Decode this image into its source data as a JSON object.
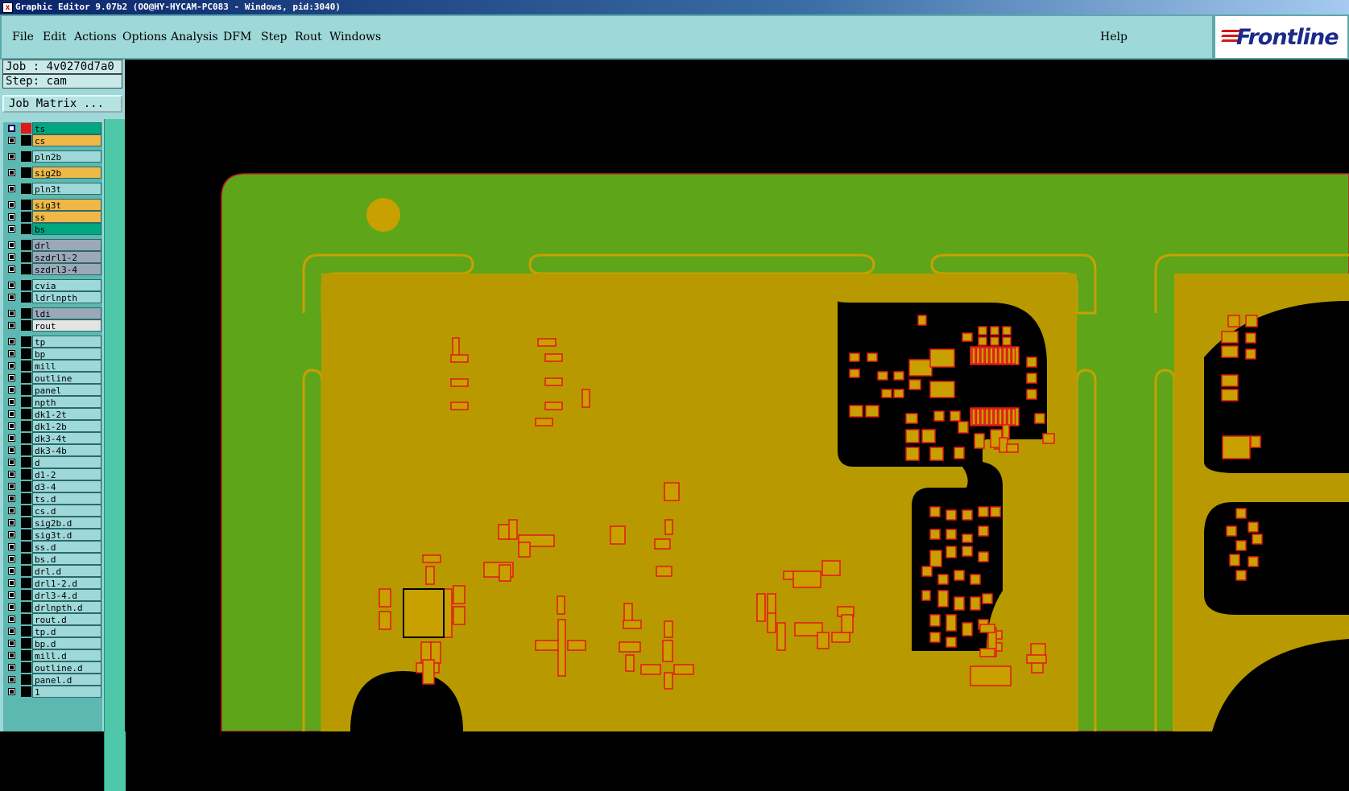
{
  "window": {
    "title": "Graphic Editor 9.07b2 (OO@HY-HYCAM-PC083 - Windows, pid:3040)"
  },
  "menu": {
    "items": [
      "File",
      "Edit",
      "Actions",
      "Options",
      "Analysis",
      "DFM",
      "Step",
      "Rout",
      "Windows"
    ],
    "help": "Help"
  },
  "logo": {
    "text": "Frontline"
  },
  "job": {
    "label": "Job : 4v0270d7a0",
    "step": "Step: cam"
  },
  "job_matrix_button": "Job Matrix ...",
  "layers": [
    {
      "name": "ts",
      "color": "#00a880",
      "active": true
    },
    {
      "name": "cs",
      "color": "#f0b848"
    },
    {
      "name": "pln2b",
      "color": "#9ed8d8"
    },
    {
      "name": "sig2b",
      "color": "#f0b848"
    },
    {
      "name": "pln3t",
      "color": "#9ed8d8"
    },
    {
      "name": "sig3t",
      "color": "#f0b848"
    },
    {
      "name": "ss",
      "color": "#f0b848"
    },
    {
      "name": "bs",
      "color": "#00a880"
    },
    {
      "name": "drl",
      "color": "#9aa8b8"
    },
    {
      "name": "szdrl1-2",
      "color": "#9aa8b8"
    },
    {
      "name": "szdrl3-4",
      "color": "#9aa8b8"
    },
    {
      "name": "cvia",
      "color": "#9ed8d8"
    },
    {
      "name": "ldrlnpth",
      "color": "#9ed8d8"
    },
    {
      "name": "ldi",
      "color": "#9aa8b8"
    },
    {
      "name": "rout",
      "color": "#e4e4e4"
    },
    {
      "name": "tp",
      "color": "#9ed8d8"
    },
    {
      "name": "bp",
      "color": "#9ed8d8"
    },
    {
      "name": "mill",
      "color": "#9ed8d8"
    },
    {
      "name": "outline",
      "color": "#9ed8d8"
    },
    {
      "name": "panel",
      "color": "#9ed8d8"
    },
    {
      "name": "npth",
      "color": "#9ed8d8"
    },
    {
      "name": "dk1-2t",
      "color": "#9ed8d8"
    },
    {
      "name": "dk1-2b",
      "color": "#9ed8d8"
    },
    {
      "name": "dk3-4t",
      "color": "#9ed8d8"
    },
    {
      "name": "dk3-4b",
      "color": "#9ed8d8"
    },
    {
      "name": "d",
      "color": "#9ed8d8"
    },
    {
      "name": "d1-2",
      "color": "#9ed8d8"
    },
    {
      "name": "d3-4",
      "color": "#9ed8d8"
    },
    {
      "name": "ts.d",
      "color": "#9ed8d8"
    },
    {
      "name": "cs.d",
      "color": "#9ed8d8"
    },
    {
      "name": "sig2b.d",
      "color": "#9ed8d8"
    },
    {
      "name": "sig3t.d",
      "color": "#9ed8d8"
    },
    {
      "name": "ss.d",
      "color": "#9ed8d8"
    },
    {
      "name": "bs.d",
      "color": "#9ed8d8"
    },
    {
      "name": "drl.d",
      "color": "#9ed8d8"
    },
    {
      "name": "drl1-2.d",
      "color": "#9ed8d8"
    },
    {
      "name": "drl3-4.d",
      "color": "#9ed8d8"
    },
    {
      "name": "drlnpth.d",
      "color": "#9ed8d8"
    },
    {
      "name": "rout.d",
      "color": "#9ed8d8"
    },
    {
      "name": "tp.d",
      "color": "#9ed8d8"
    },
    {
      "name": "bp.d",
      "color": "#9ed8d8"
    },
    {
      "name": "mill.d",
      "color": "#9ed8d8"
    },
    {
      "name": "outline.d",
      "color": "#9ed8d8"
    },
    {
      "name": "panel.d",
      "color": "#9ed8d8"
    },
    {
      "name": "1",
      "color": "#9ed8d8"
    }
  ],
  "colors": {
    "board_green": "#5ea51a",
    "copper": "#b89a00",
    "pad_outline": "#e01818",
    "pad_fill": "#c8a000",
    "background": "#000000"
  }
}
